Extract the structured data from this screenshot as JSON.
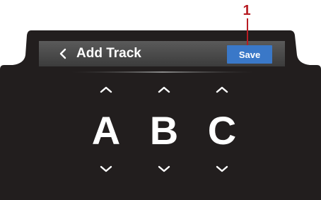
{
  "callout": {
    "number": "1"
  },
  "header": {
    "back_icon": "chevron-left-icon",
    "title": "Add Track",
    "save_label": "Save"
  },
  "letters": [
    {
      "char": "A",
      "up_icon": "chevron-up-icon",
      "down_icon": "chevron-down-icon"
    },
    {
      "char": "B",
      "up_icon": "chevron-up-icon",
      "down_icon": "chevron-down-icon"
    },
    {
      "char": "C",
      "up_icon": "chevron-up-icon",
      "down_icon": "chevron-down-icon"
    }
  ],
  "colors": {
    "screen_bg": "#221e1e",
    "bar_bg": "#4a4a4a",
    "save_bg": "#3a78c8",
    "callout": "#b81d24"
  }
}
